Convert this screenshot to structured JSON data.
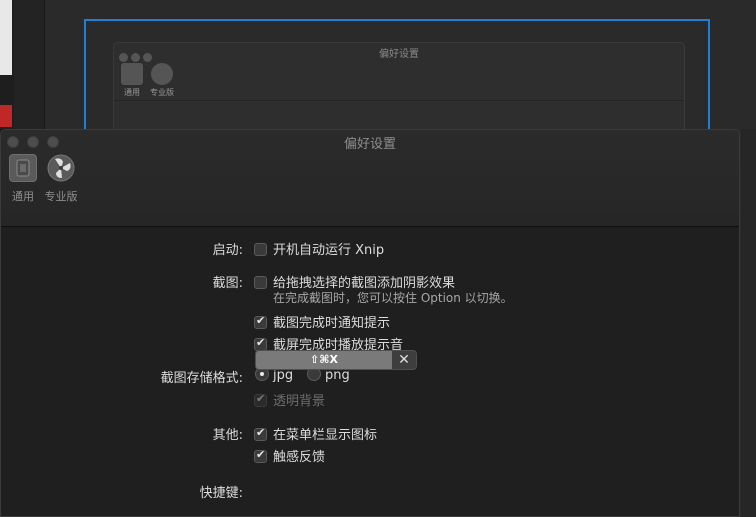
{
  "background": {
    "ghost_window": {
      "title": "偏好设置",
      "tools": [
        "通用",
        "专业版"
      ],
      "fragment": "启动:  开机自动运行"
    },
    "selection_color": "#1f7fd6"
  },
  "window": {
    "title": "偏好设置",
    "toolbar": {
      "general_label": "通用",
      "pro_label": "专业版"
    }
  },
  "prefs": {
    "startup": {
      "label": "启动:",
      "launch_at_login": {
        "text": "开机自动运行 Xnip",
        "checked": false
      }
    },
    "screenshot": {
      "label": "截图:",
      "add_shadow": {
        "text": "给拖拽选择的截图添加阴影效果",
        "checked": false
      },
      "shadow_hint": "在完成截图时，您可以按住 Option 以切换。",
      "notify_done": {
        "text": "截图完成时通知提示",
        "checked": true
      },
      "sound_done": {
        "text": "截屏完成时播放提示音",
        "checked": true
      }
    },
    "format": {
      "label": "截图存储格式:",
      "jpg": {
        "text": "jpg",
        "selected": true
      },
      "png": {
        "text": "png",
        "selected": false
      },
      "transparent_bg": {
        "text": "透明背景",
        "checked": true,
        "disabled": true
      }
    },
    "other": {
      "label": "其他:",
      "menubar_icon": {
        "text": "在菜单栏显示图标",
        "checked": true
      },
      "haptic": {
        "text": "触感反馈",
        "checked": true
      }
    },
    "shortcut": {
      "label": "快捷键:",
      "value": "⇧⌘X",
      "clear": "✕"
    }
  }
}
